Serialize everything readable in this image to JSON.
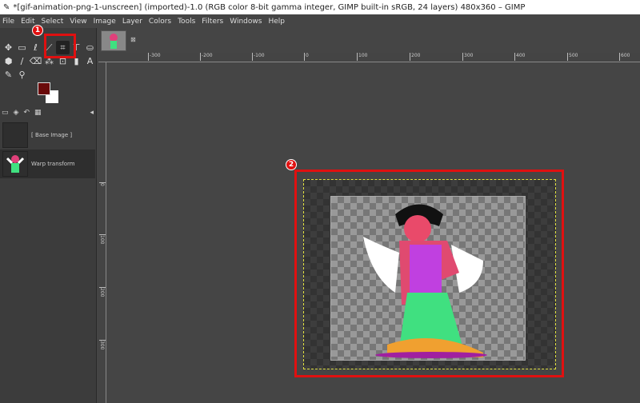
{
  "title": "*[gif-animation-png-1-unscreen] (imported)-1.0 (RGB color 8-bit gamma integer, GIMP built-in sRGB, 24 layers) 480x360 – GIMP",
  "menu": [
    "File",
    "Edit",
    "Select",
    "View",
    "Image",
    "Layer",
    "Colors",
    "Tools",
    "Filters",
    "Windows",
    "Help"
  ],
  "tools": [
    "✥",
    "▭",
    "ℓ",
    "⟋",
    "⌗",
    "⊤",
    "⛀",
    "⬢",
    "∕",
    "⌫",
    "⁂",
    "⊡",
    "▮",
    "A",
    "✎",
    "⚲"
  ],
  "badges": {
    "one": "1",
    "two": "2"
  },
  "layers": [
    {
      "name": "[ Base Image ]"
    },
    {
      "name": "Warp transform"
    }
  ],
  "ruler_h": [
    "-300",
    "-200",
    "-100",
    "0",
    "100",
    "200",
    "300",
    "400",
    "500",
    "600"
  ],
  "ruler_v": [
    "0",
    "100",
    "200",
    "300"
  ],
  "colors": {
    "foreground": "#6a0a0a",
    "background": "#ffffff",
    "highlight": "#e01010"
  }
}
